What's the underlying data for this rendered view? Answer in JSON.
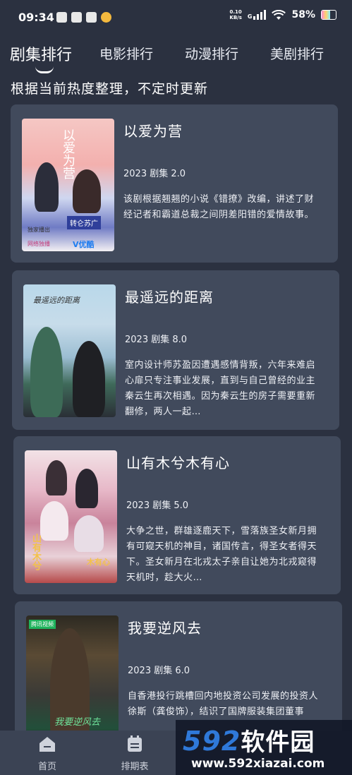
{
  "status_bar": {
    "time": "09:34",
    "net_speed_value": "0.10",
    "net_speed_unit": "KB/s",
    "signal_label": "G",
    "battery": "58%",
    "app_icons": [
      "gallery-app-icon",
      "cloud-app-icon",
      "mail-app-icon",
      "weibo-app-icon"
    ]
  },
  "tabs": [
    {
      "label": "剧集排行",
      "active": true
    },
    {
      "label": "电影排行",
      "active": false
    },
    {
      "label": "动漫排行",
      "active": false
    },
    {
      "label": "美剧排行",
      "active": false
    }
  ],
  "subtitle": "根据当前热度整理，不定时更新",
  "cards": [
    {
      "title": "以爱为营",
      "meta": "2023 剧集 2.0",
      "desc": "该剧根据翘翘的小说《错撩》改编，讲述了财经记者和霸道总裁之间阴差阳错的爱情故事。",
      "poster_text": [
        "以爱为营",
        "转仑苏广",
        "独家播出",
        "网络独播",
        "V优酷"
      ]
    },
    {
      "title": "最遥远的距离",
      "meta": "2023 剧集 8.0",
      "desc": "室内设计师苏盈因遭遇感情背叛，六年来难启心扉只专注事业发展，直到与自己曾经的业主秦云生再次相遇。因为秦云生的房子需要重新翻修，两人一起…",
      "poster_text": [
        "最遥远的距离"
      ]
    },
    {
      "title": "山有木兮木有心",
      "meta": "2023 剧集 5.0",
      "desc": "大争之世，群雄逐鹿天下，雪落族圣女新月拥有可窥天机的神目，诸国传言，得圣女者得天下。圣女新月在北戎太子亲自让她为北戎窥得天机时，趁大火…",
      "poster_text": [
        "山有木兮",
        "木有心"
      ]
    },
    {
      "title": "我要逆风去",
      "meta": "2023 剧集 6.0",
      "desc": "自香港投行跳槽回内地投资公司发展的投资人徐斯（龚俊饰），结识了国牌服装集团董事",
      "poster_text": [
        "腾讯视频",
        "我要逆风去"
      ]
    }
  ],
  "bottom_nav": [
    {
      "label": "首页",
      "icon": "home-icon"
    },
    {
      "label": "排期表",
      "icon": "calendar-icon"
    }
  ],
  "watermark": {
    "logo_number": "592",
    "logo_text": "软件园",
    "url": "www.592xiazai.com"
  }
}
